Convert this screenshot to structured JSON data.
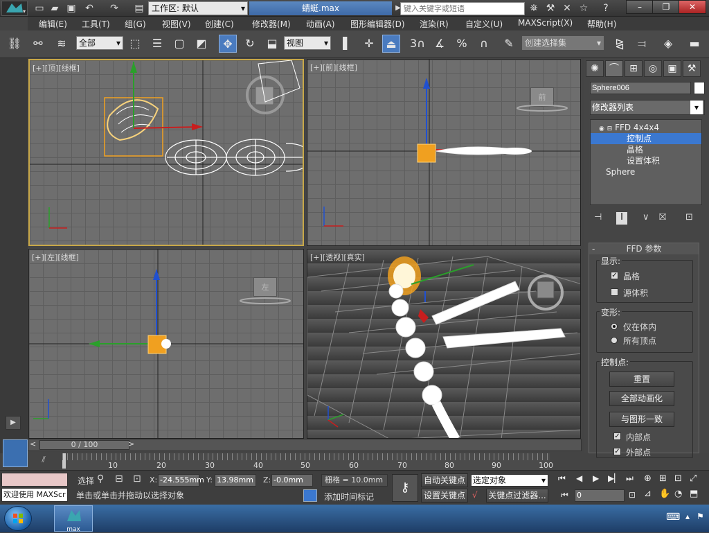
{
  "title_bar": {
    "workspace_label": "工作区: 默认",
    "document_title": "蜻蜓.max",
    "search_placeholder": "键入关键字或短语"
  },
  "menu": [
    "编辑(E)",
    "工具(T)",
    "组(G)",
    "视图(V)",
    "创建(C)",
    "修改器(M)",
    "动画(A)",
    "图形编辑器(D)",
    "渲染(R)",
    "自定义(U)",
    "MAXScript(X)",
    "帮助(H)"
  ],
  "toolbar": {
    "selection_filter": "全部",
    "reference_coord": "视图",
    "snap_label": "3",
    "angle_snap_label": "n",
    "percent_snap_label": "%",
    "named_selection_placeholder": "创建选择集"
  },
  "viewports": [
    {
      "label": "[+][顶][线框]",
      "name": "top"
    },
    {
      "label": "[+][前][线框]",
      "name": "front"
    },
    {
      "label": "[+][左][线框]",
      "name": "left"
    },
    {
      "label": "[+][透视][真实]",
      "name": "perspective"
    }
  ],
  "viewcube_labels": {
    "front": "前",
    "left": "左"
  },
  "command_panel": {
    "object_name": "Sphere006",
    "modifier_list": "修改器列表",
    "stack": [
      {
        "label": "FFD 4x4x4",
        "level": 0
      },
      {
        "label": "控制点",
        "level": 1,
        "selected": true
      },
      {
        "label": "晶格",
        "level": 1
      },
      {
        "label": "设置体积",
        "level": 1
      },
      {
        "label": "Sphere",
        "level": 0
      }
    ],
    "rollout_title": "FFD 参数",
    "display_group": "显示:",
    "display_lattice": "晶格",
    "display_source_volume": "源体积",
    "deform_group": "变形:",
    "deform_inside": "仅在体内",
    "deform_all": "所有顶点",
    "control_points_group": "控制点:",
    "btn_reset": "重置",
    "btn_animate_all": "全部动画化",
    "btn_conform": "与图形一致",
    "chk_inside": "内部点",
    "chk_outside": "外部点"
  },
  "time_slider": {
    "label": "0 / 100"
  },
  "trackbar_ticks": [
    "10",
    "20",
    "30",
    "40",
    "50",
    "60",
    "70",
    "80",
    "90",
    "100"
  ],
  "status": {
    "selection_state": "选择",
    "x_label": "X:",
    "x_value": "-24.555mm",
    "y_label": "Y:",
    "y_value": "13.98mm",
    "z_label": "Z:",
    "z_value": "-0.0mm",
    "grid": "栅格 = 10.0mm",
    "auto_key": "自动关键点",
    "set_key": "设置关键点",
    "key_mode": "选定对象",
    "key_filters": "关键点过滤器...",
    "add_time_tag": "添加时间标记",
    "prompt": "单击或单击并拖动以选择对象",
    "maxscript_listener": "欢迎使用 MAXScr",
    "frame": "0"
  },
  "taskbar": {
    "app_label": "max"
  },
  "colors": {
    "accent": "#3b78d0",
    "selected_viewport": "#c8a848",
    "gizmo_orange": "#f0a020"
  }
}
